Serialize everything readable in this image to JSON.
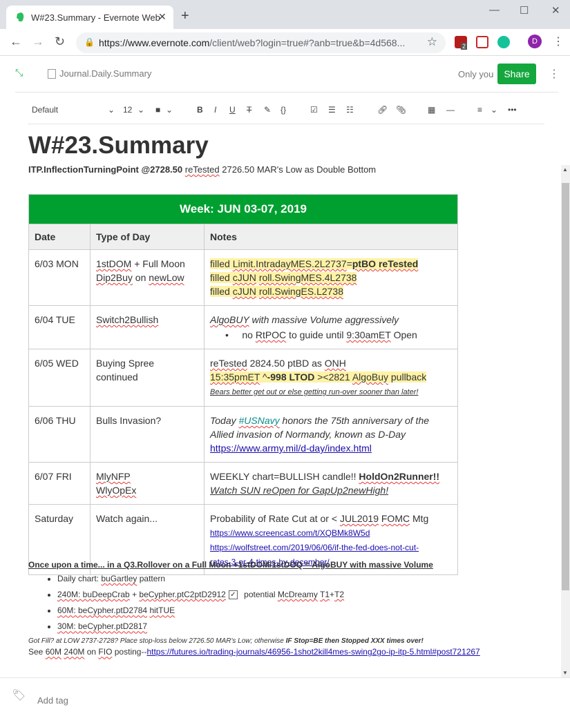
{
  "browser": {
    "tab_title": "W#23.Summary - Evernote Web",
    "url_host": "https://www.evernote.com",
    "url_path": "/client/web?login=true#?anb=true&b=4d568...",
    "avatar_letter": "D",
    "ext_badge": "2"
  },
  "header": {
    "breadcrumb": "Journal.Daily.Summary",
    "only_you": "Only you",
    "share_label": "Share"
  },
  "format_bar": {
    "style": "Default",
    "size": "12"
  },
  "note": {
    "title": "W#23.Summary",
    "subtitle_bold": "ITP.InflectionTurningPoint @2728.50",
    "subtitle_sq": "reTested",
    "subtitle_rest": "2726.50 MAR's Low as Double Bottom",
    "table": {
      "heading": "Week: JUN 03-07, 2019",
      "col_date": "Date",
      "col_type": "Type of Day",
      "col_notes": "Notes",
      "r1": {
        "date": "6/03 MON",
        "t1a": "1stDOM",
        "t1b": " + Full Moon",
        "t2a": "Dip2Buy",
        "t2b": " on ",
        "t2c": "newLow",
        "n1a": "filled ",
        "n1b": "Limit.IntradayMES.2L2737",
        "n1c": "=",
        "n1d": "ptBO reTested",
        "n2a": "filled ",
        "n2b": "cJUN",
        "n2c": " ",
        "n2d": "roll.SwingMES.4L2738",
        "n3a": "filled ",
        "n3b": "cJUN",
        "n3c": " ",
        "n3d": "roll.SwingES.L2738"
      },
      "r2": {
        "date": "6/04 TUE",
        "type": "Switch2Bullish",
        "n1a": "AlgoBUY",
        "n1b": " with massive Volume  aggressively",
        "b1": "no ",
        "b2": "RtPOC",
        "b3": " to guide until ",
        "b4": "9:30amET",
        "b5": " Open"
      },
      "r3": {
        "date": "6/05 WED",
        "type": "Buying Spree continued",
        "n1a": "reTested",
        "n1b": " 2824.50 ",
        "n1c": "ptBD",
        "n1d": " as ",
        "n1e": "ONH",
        "n2a": "15:35pmET",
        "n2b": " ^",
        "n2c": "-998 LTOD",
        "n2d": " ><2821 ",
        "n2e": "AlgoBuy",
        "n2f": " pullback",
        "n3": "Bears better get out or else getting run-over sooner than later!"
      },
      "r4": {
        "date": "6/06 THU",
        "type": "Bulls Invasion?",
        "n1a": "Today ",
        "n1b": "#USNavy",
        "n1c": " honors the 75th anniversary of the",
        "n2": "Allied invasion of Normandy, known as D-Day",
        "n3": "https://www.army.mil/d-day/index.html"
      },
      "r5": {
        "date": "6/07 FRI",
        "t1": "MlyNFP",
        "t2": "WlyOpEx",
        "n1a": "WEEKLY chart=BULLISH candle!!  ",
        "n1b": "HoldOn2Runner!!",
        "n2a": "Watch ",
        "n2b": "SUN",
        "n2c": " ",
        "n2d": "reOpen",
        "n2e": " for ",
        "n2f": "GapUp2newHigh!"
      },
      "r6": {
        "date": "Saturday",
        "type": "Watch again...",
        "n1a": "Probability of Rate Cut at or < ",
        "n1b": "JUL2019",
        "n1c": " ",
        "n1d": "FOMC",
        "n1e": " Mtg",
        "n2": "https://www.screencast.com/t/XQBMk8W5d",
        "n3": "https://wolfstreet.com/2019/06/06/if-the-fed-does-not-cut-",
        "n4": "rates-3-or-4-times-by-december/"
      }
    },
    "summary_head": "Once upon a time... in a Q3.Rollover on a Full Moon +1stDOM/1stDOQ = AlgoBUY with massive Volume ",
    "bullets": {
      "b1a": "Daily chart: ",
      "b1b": "buGartley",
      "b1c": " pattern",
      "b2a": "240M: buDeepCrab",
      "b2b": " + ",
      "b2c": "beCypher.ptC2ptD2912",
      "b2d": " potential ",
      "b2e": "McDreamy",
      "b2f": " ",
      "b2g": "T1",
      "b2h": "+",
      "b2i": "T2",
      "b3a": "60M: beCypher.ptD2784",
      "b3b": " ",
      "b3c": "hitTUE",
      "b4": "30M: beCypher.ptD2817"
    },
    "gotfill_a": "Got Fill? at LOW 2737-2728?  Place stop-loss below 2726.50 MAR's Low; otherwise ",
    "gotfill_b": "IF Stop=BE then Stopped XXX times over!",
    "see_a": "See ",
    "see_b": "60M",
    "see_c": " ",
    "see_d": "240M",
    "see_e": " on ",
    "see_f": "FIO",
    "see_g": " posting--",
    "see_link": "https://futures.io/trading-journals/46956-1shot2kill4mes-swing2go-ip-itp-5.html#post721267"
  },
  "tags": {
    "placeholder": "Add tag"
  },
  "colors": {
    "accent": "#14a73e",
    "table_header": "#00a030",
    "highlight": "#fdf2a6"
  }
}
